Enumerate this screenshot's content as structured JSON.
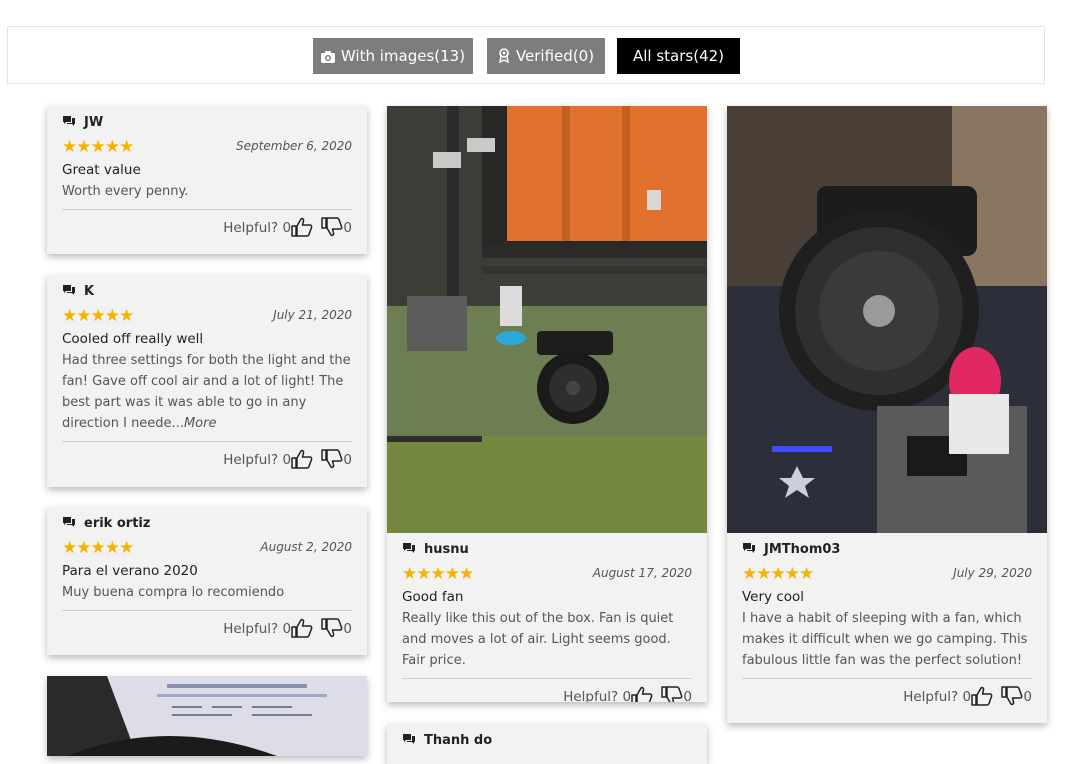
{
  "filters": {
    "with_images": "With images(13)",
    "verified": "Verified(0)",
    "all_stars": "All stars(42)"
  },
  "helpful_label": "Helpful?",
  "stars": "★★★★★",
  "colors": {
    "star": "#f5b300",
    "active_filter": "#000000",
    "inactive_filter": "#7d7d7d"
  },
  "reviews": [
    {
      "author": "JW",
      "date": "September 6, 2020",
      "title": "Great value",
      "text": "Worth every penny.",
      "more": "",
      "up": "0",
      "down": "0"
    },
    {
      "author": "K",
      "date": "July 21, 2020",
      "title": "Cooled off really well",
      "text": "Had three settings for both the light and the fan! Gave off cool air and a lot of light! The best part was it was able to go in any direction I neede...",
      "more": "More",
      "up": "0",
      "down": "0"
    },
    {
      "author": "erik ortiz",
      "date": "August 2, 2020",
      "title": "Para el verano 2020",
      "text": "Muy buena compra lo recomiendo",
      "more": "",
      "up": "0",
      "down": "0"
    },
    {
      "author": "husnu",
      "date": "August 17, 2020",
      "title": "Good fan",
      "text": "Really like this out of the box. Fan is quiet and moves a lot of air. Light seems good. Fair price.",
      "more": "",
      "up": "0",
      "down": "0"
    },
    {
      "author": "JMThom03",
      "date": "July 29, 2020",
      "title": "Very cool",
      "text": "I have a habit of sleeping with a fan, which makes it difficult when we go camping. This fabulous little fan was the perfect solution!",
      "more": "",
      "up": "0",
      "down": "0"
    },
    {
      "author": "Thanh do"
    }
  ]
}
